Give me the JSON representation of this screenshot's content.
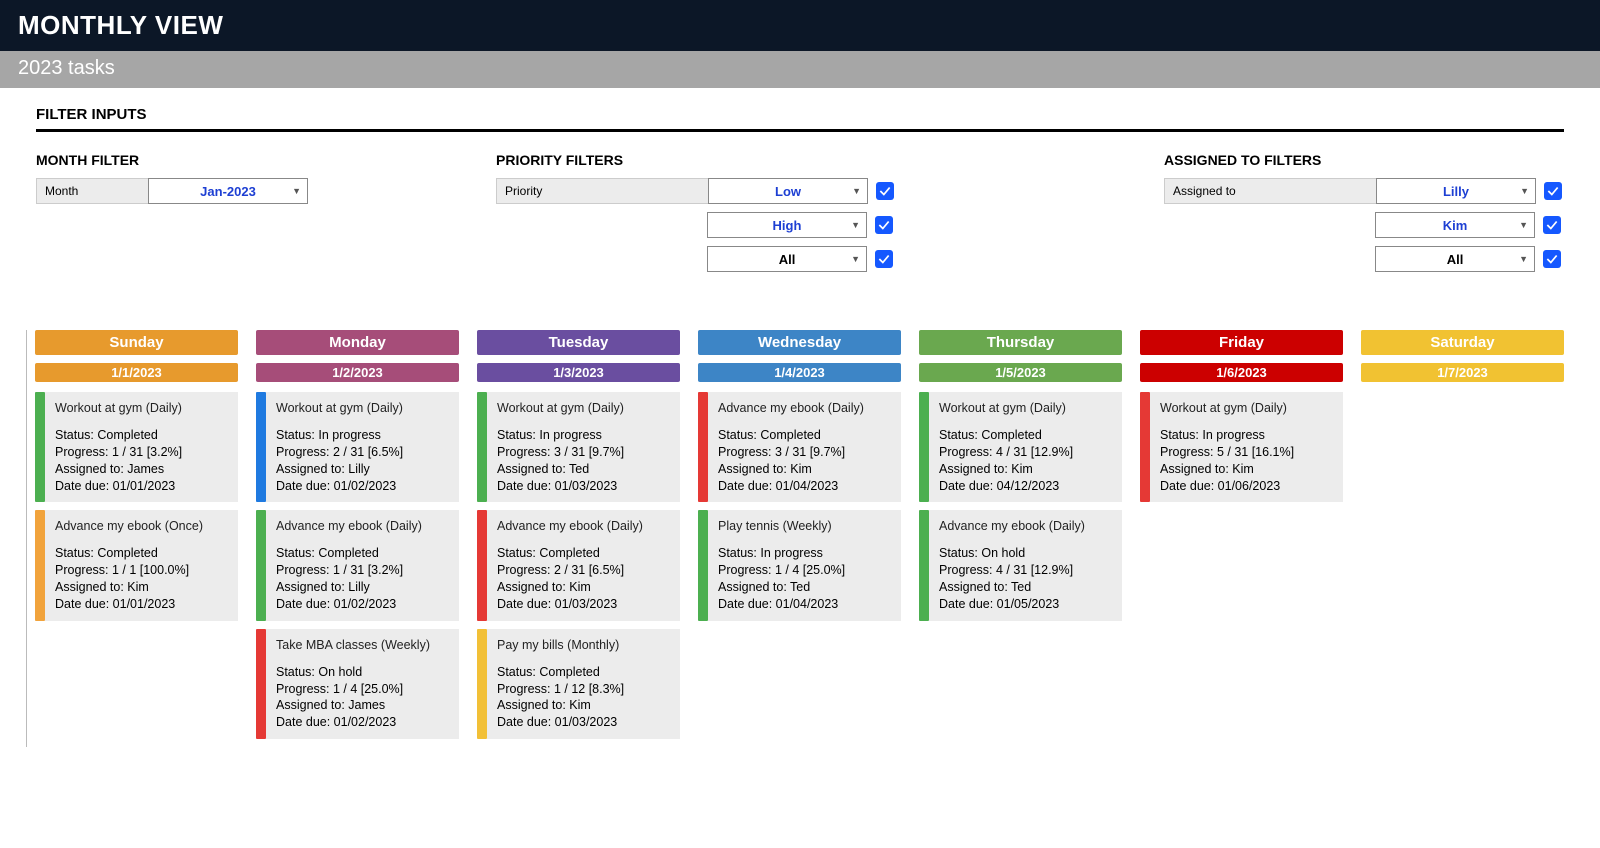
{
  "header": {
    "title": "MONTHLY VIEW",
    "subtitle": "2023 tasks"
  },
  "filters": {
    "section_title": "FILTER INPUTS",
    "month": {
      "heading": "MONTH FILTER",
      "label": "Month",
      "value": "Jan-2023"
    },
    "priority": {
      "heading": "PRIORITY FILTERS",
      "label": "Priority",
      "options": [
        {
          "value": "Low",
          "blue": true
        },
        {
          "value": "High",
          "blue": true
        },
        {
          "value": "All",
          "blue": false
        }
      ]
    },
    "assigned": {
      "heading": "ASSIGNED TO FILTERS",
      "label": "Assigned to",
      "options": [
        {
          "value": "Lilly",
          "blue": true
        },
        {
          "value": "Kim",
          "blue": true
        },
        {
          "value": "All",
          "blue": false
        }
      ]
    }
  },
  "week": [
    {
      "name": "Sunday",
      "date": "1/1/2023",
      "head_class": "c-sun",
      "tasks": [
        {
          "stripe": "s-green",
          "title": "Workout at gym (Daily)",
          "status": "Status: Completed",
          "progress": "Progress: 1 / 31  [3.2%]",
          "assigned": "Assigned to: James",
          "due": "Date due: 01/01/2023"
        },
        {
          "stripe": "s-orange",
          "title": "Advance my ebook (Once)",
          "status": "Status: Completed",
          "progress": "Progress: 1 / 1  [100.0%]",
          "assigned": "Assigned to: Kim",
          "due": "Date due: 01/01/2023"
        }
      ]
    },
    {
      "name": "Monday",
      "date": "1/2/2023",
      "head_class": "c-mon",
      "tasks": [
        {
          "stripe": "s-blue",
          "title": "Workout at gym (Daily)",
          "status": "Status: In progress",
          "progress": "Progress: 2 / 31  [6.5%]",
          "assigned": "Assigned to: Lilly",
          "due": "Date due: 01/02/2023"
        },
        {
          "stripe": "s-green",
          "title": "Advance my ebook (Daily)",
          "status": "Status: Completed",
          "progress": "Progress: 1 / 31  [3.2%]",
          "assigned": "Assigned to: Lilly",
          "due": "Date due: 01/02/2023"
        },
        {
          "stripe": "s-red",
          "title": "Take MBA classes (Weekly)",
          "status": "Status: On hold",
          "progress": "Progress: 1 / 4  [25.0%]",
          "assigned": "Assigned to: James",
          "due": "Date due: 01/02/2023"
        }
      ]
    },
    {
      "name": "Tuesday",
      "date": "1/3/2023",
      "head_class": "c-tue",
      "tasks": [
        {
          "stripe": "s-green",
          "title": "Workout at gym (Daily)",
          "status": "Status: In progress",
          "progress": "Progress: 3 / 31  [9.7%]",
          "assigned": "Assigned to: Ted",
          "due": "Date due: 01/03/2023"
        },
        {
          "stripe": "s-red",
          "title": "Advance my ebook (Daily)",
          "status": "Status: Completed",
          "progress": "Progress: 2 / 31  [6.5%]",
          "assigned": "Assigned to: Kim",
          "due": "Date due: 01/03/2023"
        },
        {
          "stripe": "s-yellow",
          "title": "Pay my bills (Monthly)",
          "status": "Status: Completed",
          "progress": "Progress: 1 / 12  [8.3%]",
          "assigned": "Assigned to: Kim",
          "due": "Date due: 01/03/2023"
        }
      ]
    },
    {
      "name": "Wednesday",
      "date": "1/4/2023",
      "head_class": "c-wed",
      "tasks": [
        {
          "stripe": "s-red",
          "title": "Advance my ebook (Daily)",
          "status": "Status: Completed",
          "progress": "Progress: 3 / 31  [9.7%]",
          "assigned": "Assigned to: Kim",
          "due": "Date due: 01/04/2023"
        },
        {
          "stripe": "s-green",
          "title": "Play tennis (Weekly)",
          "status": "Status: In progress",
          "progress": "Progress: 1 / 4  [25.0%]",
          "assigned": "Assigned to: Ted",
          "due": "Date due: 01/04/2023"
        }
      ]
    },
    {
      "name": "Thursday",
      "date": "1/5/2023",
      "head_class": "c-thu",
      "tasks": [
        {
          "stripe": "s-green",
          "title": "Workout at gym (Daily)",
          "status": "Status: Completed",
          "progress": "Progress: 4 / 31  [12.9%]",
          "assigned": "Assigned to: Kim",
          "due": "Date due: 04/12/2023"
        },
        {
          "stripe": "s-green",
          "title": "Advance my ebook (Daily)",
          "status": "Status: On hold",
          "progress": "Progress: 4 / 31  [12.9%]",
          "assigned": "Assigned to: Ted",
          "due": "Date due: 01/05/2023"
        }
      ]
    },
    {
      "name": "Friday",
      "date": "1/6/2023",
      "head_class": "c-fri",
      "tasks": [
        {
          "stripe": "s-red",
          "title": "Workout at gym (Daily)",
          "status": "Status: In progress",
          "progress": "Progress: 5 / 31  [16.1%]",
          "assigned": "Assigned to: Kim",
          "due": "Date due: 01/06/2023"
        }
      ]
    },
    {
      "name": "Saturday",
      "date": "1/7/2023",
      "head_class": "c-sat",
      "tasks": []
    }
  ]
}
